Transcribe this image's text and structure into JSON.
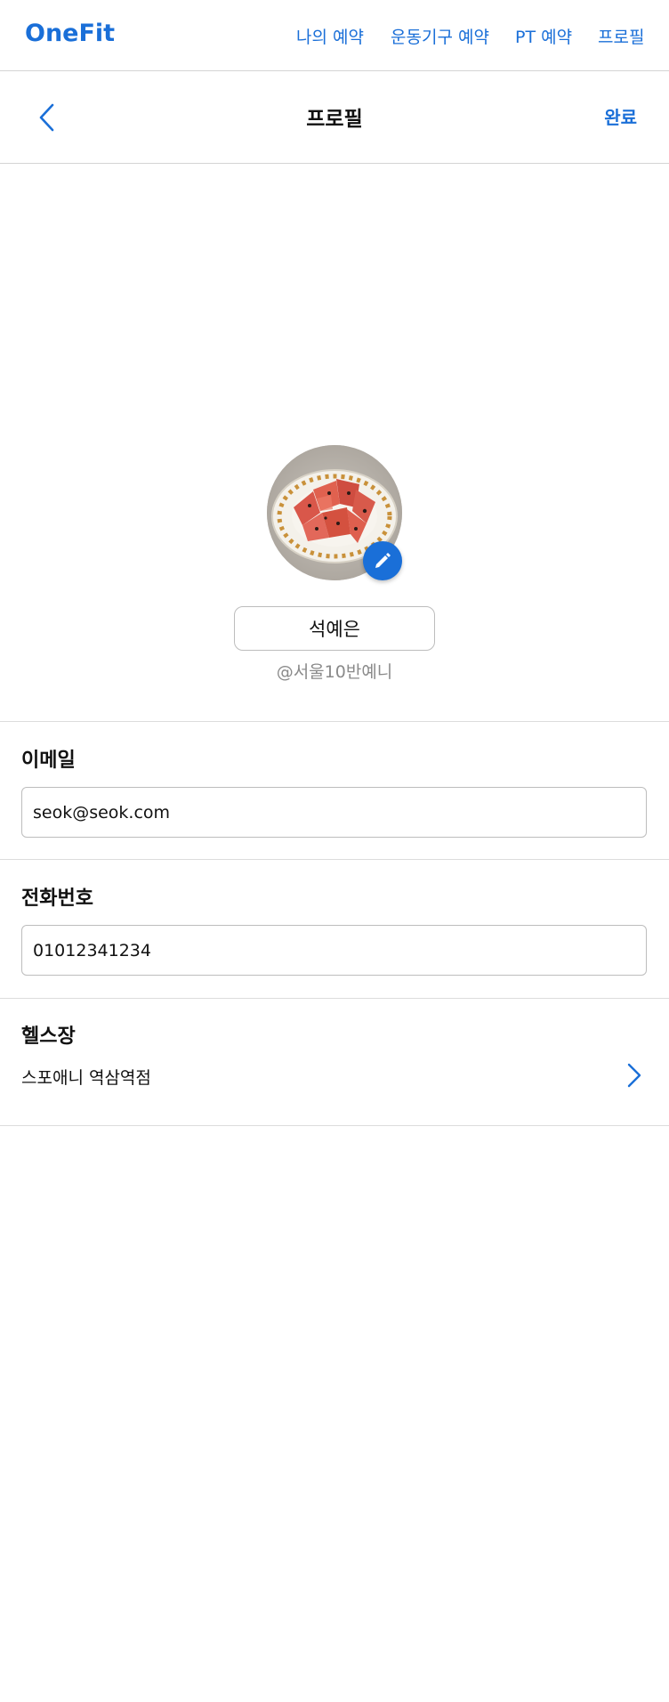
{
  "nav": {
    "brand": "OneFit",
    "links": [
      "나의 예약",
      "운동기구 예약",
      "PT 예약",
      "프로필"
    ]
  },
  "header": {
    "title": "프로필",
    "done_label": "완료",
    "back_icon": "chevron-left-icon"
  },
  "profile": {
    "name": "석예은",
    "handle": "@서울10반예니",
    "avatar_icon": "watermelon-photo",
    "edit_icon": "pencil-icon"
  },
  "fields": {
    "email_label": "이메일",
    "email_value": "seok@seok.com",
    "phone_label": "전화번호",
    "phone_value": "01012341234",
    "gym_label": "헬스장",
    "gym_value": "스포애니 역삼역점",
    "gym_icon": "chevron-right-icon"
  },
  "colors": {
    "accent": "#1a6fd8",
    "divider": "#dcdcdc",
    "muted_text": "#8a8a8a"
  }
}
